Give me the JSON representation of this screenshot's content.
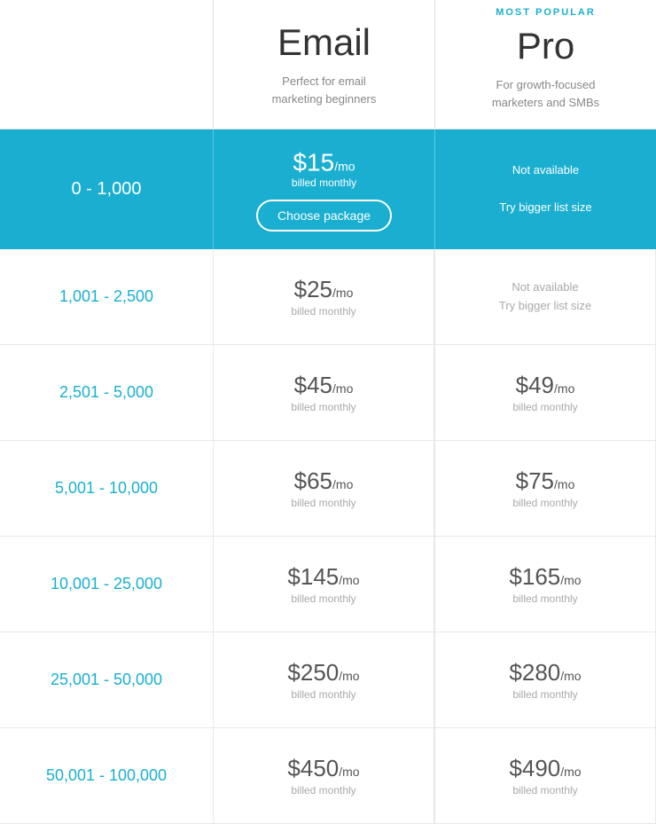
{
  "plans": {
    "email": {
      "name": "Email",
      "description_line1": "Perfect for email",
      "description_line2": "marketing beginners"
    },
    "pro": {
      "most_popular": "MOST POPULAR",
      "name": "Pro",
      "description_line1": "For growth-focused",
      "description_line2": "marketers and SMBs"
    }
  },
  "rows": [
    {
      "range": "0 - 1,000",
      "highlighted": true,
      "email_price": "$15",
      "email_per": "/mo",
      "email_billed": "billed monthly",
      "email_cta": "Choose package",
      "pro_unavail_line1": "Not available",
      "pro_unavail_line2": "Try bigger list size"
    },
    {
      "range": "1,001 - 2,500",
      "highlighted": false,
      "email_price": "$25",
      "email_per": "/mo",
      "email_billed": "billed monthly",
      "pro_unavail_line1": "Not available",
      "pro_unavail_line2": "Try bigger list size"
    },
    {
      "range": "2,501 - 5,000",
      "highlighted": false,
      "email_price": "$45",
      "email_per": "/mo",
      "email_billed": "billed monthly",
      "pro_price": "$49",
      "pro_per": "/mo",
      "pro_billed": "billed monthly"
    },
    {
      "range": "5,001 - 10,000",
      "highlighted": false,
      "email_price": "$65",
      "email_per": "/mo",
      "email_billed": "billed monthly",
      "pro_price": "$75",
      "pro_per": "/mo",
      "pro_billed": "billed monthly"
    },
    {
      "range": "10,001 - 25,000",
      "highlighted": false,
      "email_price": "$145",
      "email_per": "/mo",
      "email_billed": "billed monthly",
      "pro_price": "$165",
      "pro_per": "/mo",
      "pro_billed": "billed monthly"
    },
    {
      "range": "25,001 - 50,000",
      "highlighted": false,
      "email_price": "$250",
      "email_per": "/mo",
      "email_billed": "billed monthly",
      "pro_price": "$280",
      "pro_per": "/mo",
      "pro_billed": "billed monthly"
    },
    {
      "range": "50,001 - 100,000",
      "highlighted": false,
      "email_price": "$450",
      "email_per": "/mo",
      "email_billed": "billed monthly",
      "pro_price": "$490",
      "pro_per": "/mo",
      "pro_billed": "billed monthly"
    }
  ]
}
